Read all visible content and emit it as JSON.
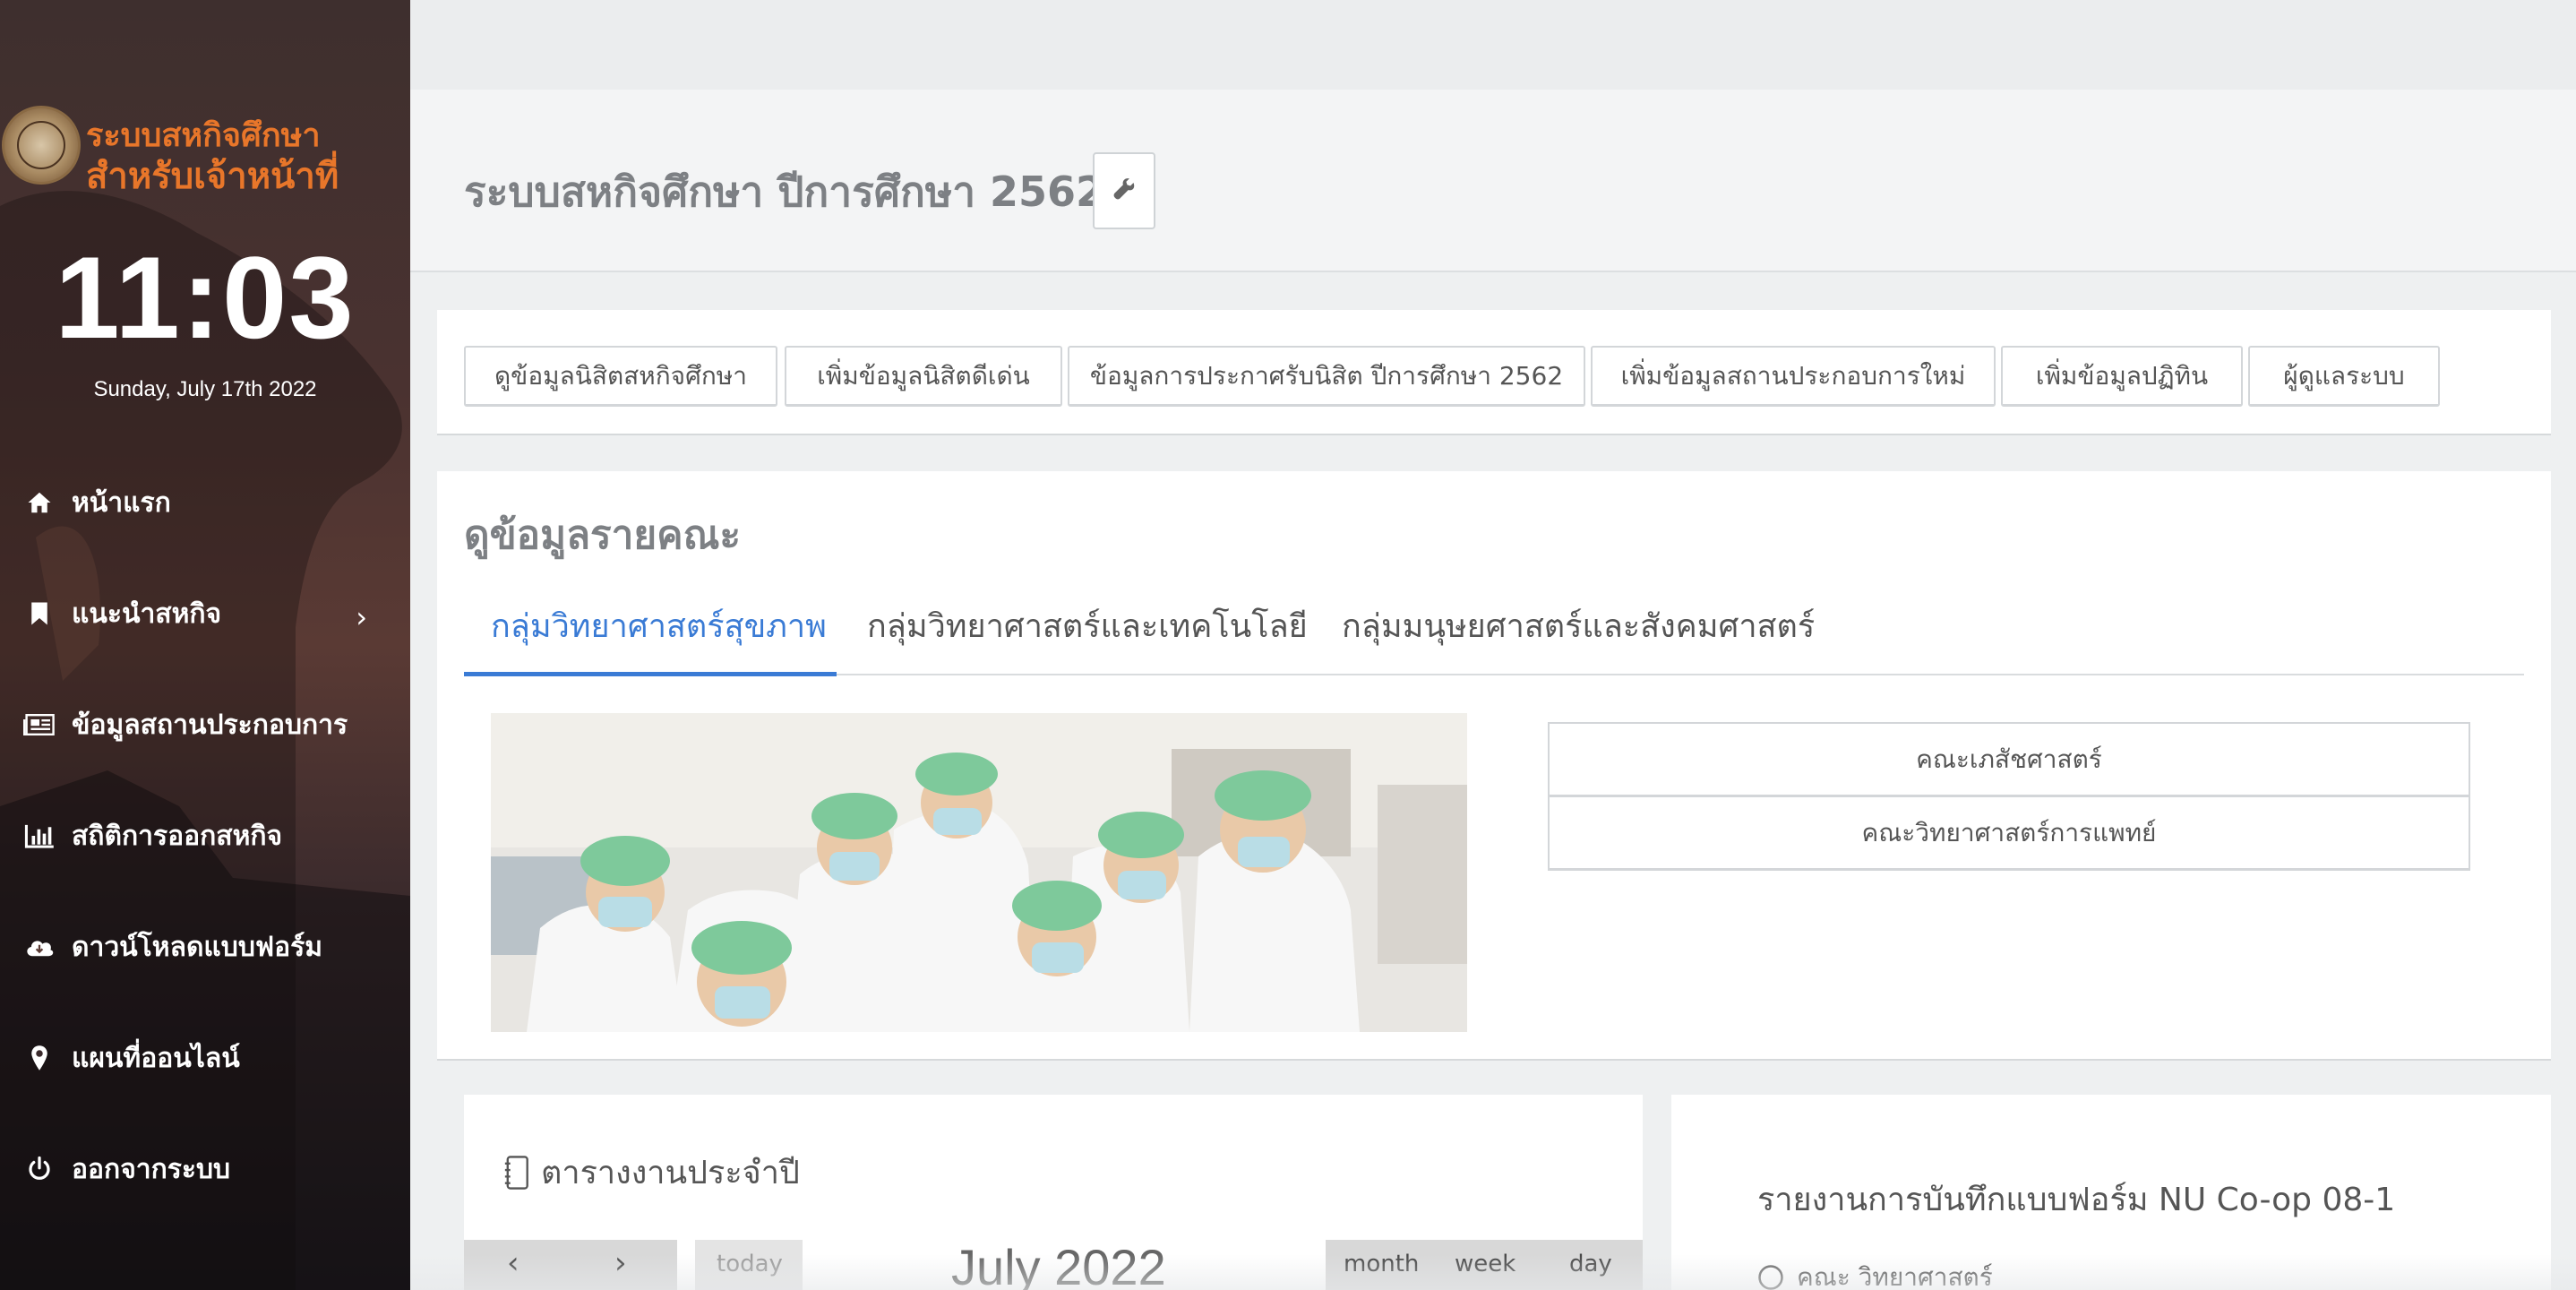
{
  "sidebar": {
    "brand": {
      "line1": "ระบบสหกิจศึกษา",
      "line2": "สำหรับเจ้าหน้าที่",
      "seal_icon": "university-seal-icon"
    },
    "clock": "11:03",
    "date": "Sunday, July 17th 2022",
    "items": [
      {
        "label": "หน้าแรก",
        "icon": "home-icon"
      },
      {
        "label": "แนะนำสหกิจ",
        "icon": "bookmark-icon",
        "chevron": "›"
      },
      {
        "label": "ข้อมูลสถานประกอบการ",
        "icon": "newspaper-icon"
      },
      {
        "label": "สถิติการออกสหกิจ",
        "icon": "bar-chart-icon"
      },
      {
        "label": "ดาวน์โหลดแบบฟอร์ม",
        "icon": "cloud-download-icon"
      },
      {
        "label": "แผนที่ออนไลน์",
        "icon": "map-marker-icon"
      },
      {
        "label": "ออกจากระบบ",
        "icon": "power-icon"
      }
    ]
  },
  "header": {
    "title": "ระบบสหกิจศึกษา ปีการศึกษา 2562",
    "settings_icon": "wrench-icon"
  },
  "quick_links": [
    "ดูข้อมูลนิสิตสหกิจศึกษา",
    "เพิ่มข้อมูลนิสิตดีเด่น",
    "ข้อมูลการประกาศรับนิสิต ปีการศึกษา 2562",
    "เพิ่มข้อมูลสถานประกอบการใหม่",
    "เพิ่มข้อมูลปฏิทิน",
    "ผู้ดูแลระบบ"
  ],
  "faculty_section": {
    "title": "ดูข้อมูลรายคณะ",
    "tabs": [
      {
        "label": "กลุ่มวิทยาศาสตร์สุขภาพ",
        "active": true
      },
      {
        "label": "กลุ่มวิทยาศาสตร์และเทคโนโลยี",
        "active": false
      },
      {
        "label": "กลุ่มมนุษยศาสตร์และสังคมศาสตร์",
        "active": false
      }
    ],
    "faculties": [
      "คณะเภสัชศาสตร์",
      "คณะวิทยาศาสตร์การแพทย์"
    ]
  },
  "calendar": {
    "title": "ตารางงานประจำปี",
    "title_icon": "notebook-icon",
    "prev": "‹",
    "next": "›",
    "today": "today",
    "month": "July 2022",
    "views": [
      "month",
      "week",
      "day"
    ]
  },
  "report": {
    "title": "รายงานการบันทึกแบบฟอร์ม NU Co-op 08-1",
    "items": [
      {
        "label": "คณะ วิทยาศาสตร์",
        "icon": "circle-icon"
      }
    ]
  },
  "colors": {
    "accent": "#3a7bd5",
    "brand_orange": "#e8762a",
    "sidebar_bg": "#3e2f2e"
  }
}
